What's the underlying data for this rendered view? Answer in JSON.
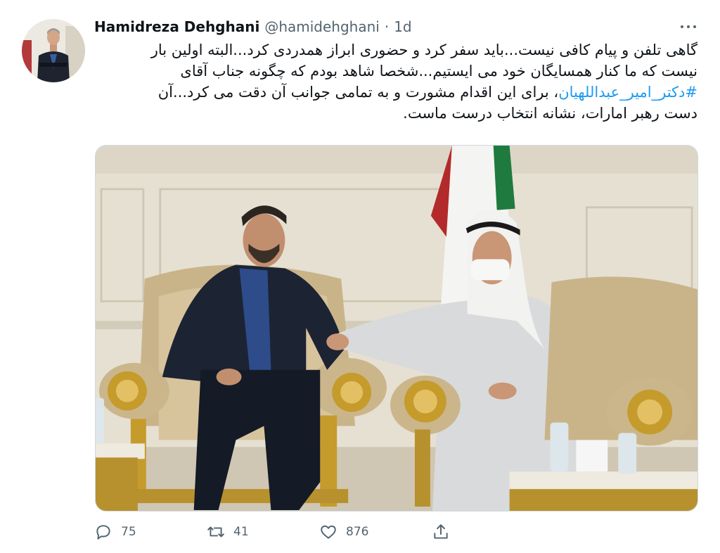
{
  "tweet": {
    "author": {
      "name": "Hamidreza Dehghani",
      "handle": "@hamidehghani",
      "separator": "·",
      "time": "1d"
    },
    "text": {
      "line1": "گاهی تلفن و پیام کافی نیست...باید سفر کرد و حضوری ابراز همدردی کرد...البته اولین بار",
      "line2": "نیست که ما کنار همسایگان خود می ایستیم...شخصا شاهد بودم که چگونه جناب آقای",
      "hashtag": "#دکتر_امیر_عبداللهیان",
      "line3_rest": "، برای این اقدام مشورت و به تمامی جوانب آن دقت می کرد...آن",
      "line4": "دست رهبر امارات، نشانه انتخاب درست ماست."
    },
    "stats": {
      "replies": "75",
      "retweets": "41",
      "likes": "876"
    }
  },
  "icons": [
    "more-options-icon",
    "reply-icon",
    "retweet-icon",
    "like-icon",
    "share-icon"
  ],
  "colors": {
    "text": "#0f1419",
    "secondary": "#536471",
    "hashtag": "#1d9bf0"
  }
}
